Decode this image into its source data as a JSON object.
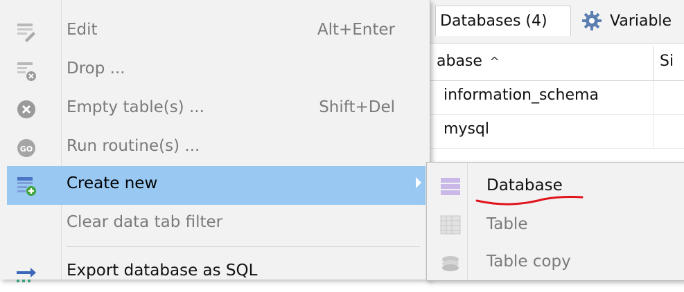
{
  "tabs": {
    "databases_label": "Databases (4)",
    "variables_label": "Variable"
  },
  "grid": {
    "col_database": "abase",
    "sort_indicator": "^",
    "col_size": "Si",
    "rows": [
      "information_schema",
      "mysql"
    ]
  },
  "context_menu": {
    "items": [
      {
        "label": "Edit",
        "shortcut": "Alt+Enter",
        "icon": "edit-icon",
        "enabled": false
      },
      {
        "label": "Drop ...",
        "shortcut": "",
        "icon": "drop-table-icon",
        "enabled": false
      },
      {
        "label": "Empty table(s) ...",
        "shortcut": "Shift+Del",
        "icon": "empty-table-icon",
        "enabled": false
      },
      {
        "label": "Run routine(s) ...",
        "shortcut": "",
        "icon": "run-routine-icon",
        "enabled": false
      },
      {
        "label": "Create new",
        "shortcut": "",
        "icon": "create-new-icon",
        "enabled": true,
        "highlighted": true,
        "has_submenu": true
      },
      {
        "label": "Clear data tab filter",
        "shortcut": "",
        "icon": "",
        "enabled": false
      },
      {
        "label": "Export database as SQL",
        "shortcut": "",
        "icon": "export-icon",
        "enabled": true
      }
    ]
  },
  "submenu": {
    "items": [
      {
        "label": "Database",
        "icon": "database-icon",
        "enabled": true
      },
      {
        "label": "Table",
        "icon": "table-icon",
        "enabled": false
      },
      {
        "label": "Table copy",
        "icon": "table-copy-icon",
        "enabled": false
      }
    ]
  },
  "colors": {
    "highlight": "#99c9f3",
    "menu_bg": "#f2f2f2",
    "disabled_text": "#7a7a7a",
    "annotation_red": "#e0141c"
  }
}
